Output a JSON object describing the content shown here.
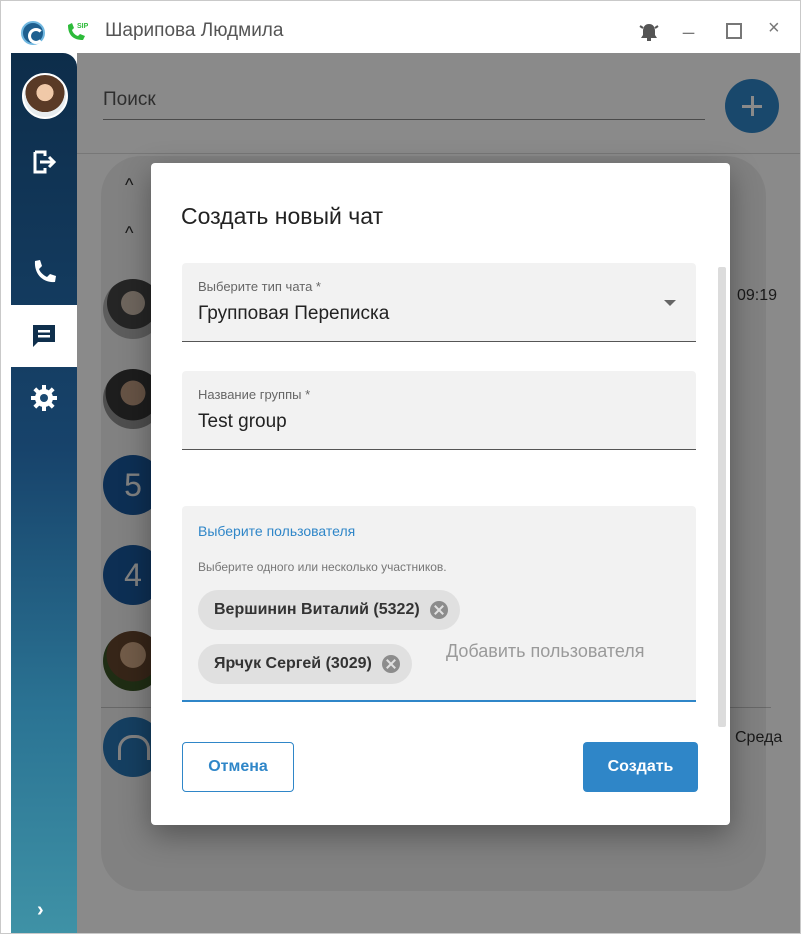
{
  "window": {
    "title": "Шарипова Людмила",
    "sip_badge": "SIP",
    "minimize_glyph": "_",
    "close_glyph": "×",
    "icons": [
      "app-logo-icon",
      "sip-phone-icon",
      "bell-icon",
      "minimize-icon",
      "maximize-icon",
      "close-icon"
    ]
  },
  "sidebar": {
    "items": [
      {
        "name": "user-avatar"
      },
      {
        "name": "logout-icon"
      },
      {
        "name": "phone-icon"
      },
      {
        "name": "chat-icon",
        "active": true
      },
      {
        "name": "settings-icon"
      }
    ],
    "expand_glyph": "›"
  },
  "search": {
    "placeholder": "Поиск"
  },
  "chat_list": {
    "collapse_glyph": "^",
    "rows": [
      {
        "avatar": "photo",
        "time": "09:19"
      },
      {
        "avatar": "photo",
        "time": ""
      },
      {
        "avatar": "number",
        "label": "5",
        "time": ""
      },
      {
        "avatar": "number",
        "label": "4",
        "time": ""
      },
      {
        "avatar": "photo",
        "time": ""
      },
      {
        "avatar": "group",
        "time": "Среда"
      }
    ]
  },
  "dialog": {
    "title": "Создать новый чат",
    "chat_type": {
      "label": "Выберите тип чата *",
      "value": "Групповая Переписка"
    },
    "group_name": {
      "label": "Название группы *",
      "value": "Test group"
    },
    "users": {
      "label": "Выберите пользователя",
      "hint": "Выберите одного или несколько участников.",
      "chips": [
        "Вершинин Виталий (5322)",
        "Ярчук Сергей (3029)"
      ],
      "add_placeholder": "Добавить пользователя"
    },
    "cancel_label": "Отмена",
    "create_label": "Создать"
  },
  "colors": {
    "accent": "#2f86c8",
    "sidebar_top": "#0d2d4a",
    "sidebar_bottom": "#3f92a6",
    "sip_green": "#2dbb3a"
  }
}
